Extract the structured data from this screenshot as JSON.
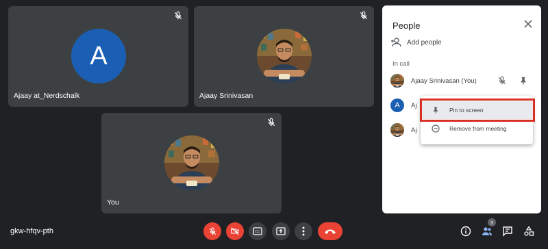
{
  "tiles": [
    {
      "name": "Ajaay at_Nerdschalk",
      "avatar_letter": "A"
    },
    {
      "name": "Ajaay Srinivasan"
    },
    {
      "name": "You"
    }
  ],
  "panel": {
    "title": "People",
    "add_people": "Add people",
    "section": "In call",
    "participants": [
      {
        "name": "Ajaay Srinivasan (You)"
      },
      {
        "name": "Aj",
        "avatar_letter": "A"
      },
      {
        "name": "Aj"
      }
    ]
  },
  "menu": {
    "pin": "Pin to screen",
    "remove": "Remove from meeting"
  },
  "footer": {
    "meeting_code": "gkw-hfqv-pth",
    "people_count": "3"
  },
  "colors": {
    "background": "#202124",
    "tile": "#3c4043",
    "red": "#ea4335",
    "highlight": "#d93025",
    "avatar_blue": "#1a5fb4"
  }
}
